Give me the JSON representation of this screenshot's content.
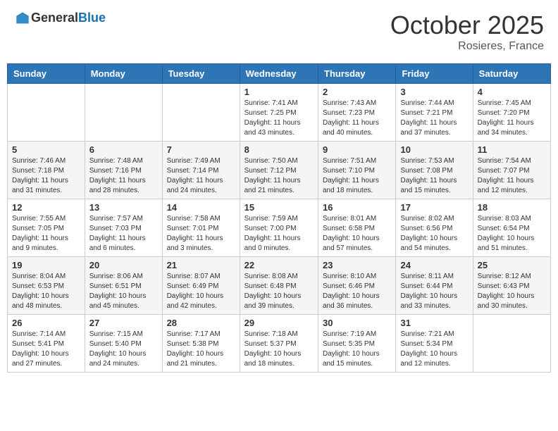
{
  "header": {
    "logo_general": "General",
    "logo_blue": "Blue",
    "month": "October 2025",
    "location": "Rosieres, France"
  },
  "weekdays": [
    "Sunday",
    "Monday",
    "Tuesday",
    "Wednesday",
    "Thursday",
    "Friday",
    "Saturday"
  ],
  "weeks": [
    [
      {
        "day": "",
        "info": ""
      },
      {
        "day": "",
        "info": ""
      },
      {
        "day": "",
        "info": ""
      },
      {
        "day": "1",
        "info": "Sunrise: 7:41 AM\nSunset: 7:25 PM\nDaylight: 11 hours and 43 minutes."
      },
      {
        "day": "2",
        "info": "Sunrise: 7:43 AM\nSunset: 7:23 PM\nDaylight: 11 hours and 40 minutes."
      },
      {
        "day": "3",
        "info": "Sunrise: 7:44 AM\nSunset: 7:21 PM\nDaylight: 11 hours and 37 minutes."
      },
      {
        "day": "4",
        "info": "Sunrise: 7:45 AM\nSunset: 7:20 PM\nDaylight: 11 hours and 34 minutes."
      }
    ],
    [
      {
        "day": "5",
        "info": "Sunrise: 7:46 AM\nSunset: 7:18 PM\nDaylight: 11 hours and 31 minutes."
      },
      {
        "day": "6",
        "info": "Sunrise: 7:48 AM\nSunset: 7:16 PM\nDaylight: 11 hours and 28 minutes."
      },
      {
        "day": "7",
        "info": "Sunrise: 7:49 AM\nSunset: 7:14 PM\nDaylight: 11 hours and 24 minutes."
      },
      {
        "day": "8",
        "info": "Sunrise: 7:50 AM\nSunset: 7:12 PM\nDaylight: 11 hours and 21 minutes."
      },
      {
        "day": "9",
        "info": "Sunrise: 7:51 AM\nSunset: 7:10 PM\nDaylight: 11 hours and 18 minutes."
      },
      {
        "day": "10",
        "info": "Sunrise: 7:53 AM\nSunset: 7:08 PM\nDaylight: 11 hours and 15 minutes."
      },
      {
        "day": "11",
        "info": "Sunrise: 7:54 AM\nSunset: 7:07 PM\nDaylight: 11 hours and 12 minutes."
      }
    ],
    [
      {
        "day": "12",
        "info": "Sunrise: 7:55 AM\nSunset: 7:05 PM\nDaylight: 11 hours and 9 minutes."
      },
      {
        "day": "13",
        "info": "Sunrise: 7:57 AM\nSunset: 7:03 PM\nDaylight: 11 hours and 6 minutes."
      },
      {
        "day": "14",
        "info": "Sunrise: 7:58 AM\nSunset: 7:01 PM\nDaylight: 11 hours and 3 minutes."
      },
      {
        "day": "15",
        "info": "Sunrise: 7:59 AM\nSunset: 7:00 PM\nDaylight: 11 hours and 0 minutes."
      },
      {
        "day": "16",
        "info": "Sunrise: 8:01 AM\nSunset: 6:58 PM\nDaylight: 10 hours and 57 minutes."
      },
      {
        "day": "17",
        "info": "Sunrise: 8:02 AM\nSunset: 6:56 PM\nDaylight: 10 hours and 54 minutes."
      },
      {
        "day": "18",
        "info": "Sunrise: 8:03 AM\nSunset: 6:54 PM\nDaylight: 10 hours and 51 minutes."
      }
    ],
    [
      {
        "day": "19",
        "info": "Sunrise: 8:04 AM\nSunset: 6:53 PM\nDaylight: 10 hours and 48 minutes."
      },
      {
        "day": "20",
        "info": "Sunrise: 8:06 AM\nSunset: 6:51 PM\nDaylight: 10 hours and 45 minutes."
      },
      {
        "day": "21",
        "info": "Sunrise: 8:07 AM\nSunset: 6:49 PM\nDaylight: 10 hours and 42 minutes."
      },
      {
        "day": "22",
        "info": "Sunrise: 8:08 AM\nSunset: 6:48 PM\nDaylight: 10 hours and 39 minutes."
      },
      {
        "day": "23",
        "info": "Sunrise: 8:10 AM\nSunset: 6:46 PM\nDaylight: 10 hours and 36 minutes."
      },
      {
        "day": "24",
        "info": "Sunrise: 8:11 AM\nSunset: 6:44 PM\nDaylight: 10 hours and 33 minutes."
      },
      {
        "day": "25",
        "info": "Sunrise: 8:12 AM\nSunset: 6:43 PM\nDaylight: 10 hours and 30 minutes."
      }
    ],
    [
      {
        "day": "26",
        "info": "Sunrise: 7:14 AM\nSunset: 5:41 PM\nDaylight: 10 hours and 27 minutes."
      },
      {
        "day": "27",
        "info": "Sunrise: 7:15 AM\nSunset: 5:40 PM\nDaylight: 10 hours and 24 minutes."
      },
      {
        "day": "28",
        "info": "Sunrise: 7:17 AM\nSunset: 5:38 PM\nDaylight: 10 hours and 21 minutes."
      },
      {
        "day": "29",
        "info": "Sunrise: 7:18 AM\nSunset: 5:37 PM\nDaylight: 10 hours and 18 minutes."
      },
      {
        "day": "30",
        "info": "Sunrise: 7:19 AM\nSunset: 5:35 PM\nDaylight: 10 hours and 15 minutes."
      },
      {
        "day": "31",
        "info": "Sunrise: 7:21 AM\nSunset: 5:34 PM\nDaylight: 10 hours and 12 minutes."
      },
      {
        "day": "",
        "info": ""
      }
    ]
  ]
}
